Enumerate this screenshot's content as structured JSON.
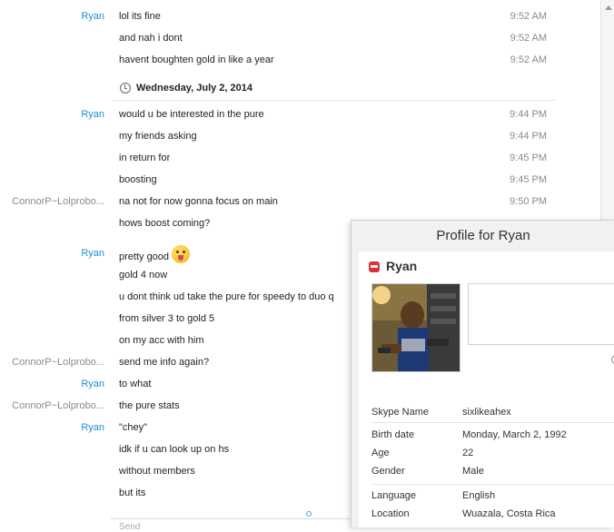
{
  "messages": [
    {
      "sender": "Ryan",
      "sender_type": "contact",
      "text": "lol its fine",
      "time": "9:52 AM"
    },
    {
      "sender": "",
      "sender_type": "contact",
      "text": "and nah i dont",
      "time": "9:52 AM"
    },
    {
      "sender": "",
      "sender_type": "contact",
      "text": "havent boughten gold in like a year",
      "time": "9:52 AM"
    }
  ],
  "date_separator": "Wednesday, July 2, 2014",
  "messages_after": [
    {
      "sender": "Ryan",
      "sender_type": "contact",
      "text": "would u be interested in the pure",
      "time": "9:44 PM"
    },
    {
      "sender": "",
      "sender_type": "contact",
      "text": "my friends asking",
      "time": "9:44 PM"
    },
    {
      "sender": "",
      "sender_type": "contact",
      "text": "in return for",
      "time": "9:45 PM"
    },
    {
      "sender": "",
      "sender_type": "contact",
      "text": "boosting",
      "time": "9:45 PM"
    },
    {
      "sender": "ConnorP~Lolprobo...",
      "sender_type": "self",
      "text": "na not for now gonna focus on main",
      "time": "9:50 PM"
    },
    {
      "sender": "",
      "sender_type": "self",
      "text": "hows boost coming?",
      "time": ""
    },
    {
      "sender": "Ryan",
      "sender_type": "contact",
      "text": "pretty good",
      "time": "",
      "emoji": "tongue-out-emoji"
    },
    {
      "sender": "",
      "sender_type": "contact",
      "text": "gold 4 now",
      "time": ""
    },
    {
      "sender": "",
      "sender_type": "contact",
      "text": "u dont think ud take the pure for speedy to duo q",
      "time": ""
    },
    {
      "sender": "",
      "sender_type": "contact",
      "text": "from silver 3 to gold 5",
      "time": ""
    },
    {
      "sender": "",
      "sender_type": "contact",
      "text": "on my acc with him",
      "time": ""
    },
    {
      "sender": "ConnorP~Lolprobo...",
      "sender_type": "self",
      "text": "send me info again?",
      "time": ""
    },
    {
      "sender": "Ryan",
      "sender_type": "contact",
      "text": "to what",
      "time": ""
    },
    {
      "sender": "ConnorP~Lolprobo...",
      "sender_type": "self",
      "text": "the pure stats",
      "time": ""
    },
    {
      "sender": "Ryan",
      "sender_type": "contact",
      "text": "\"chey\"",
      "time": ""
    },
    {
      "sender": "",
      "sender_type": "contact",
      "text": "idk if u can look up on hs",
      "time": ""
    },
    {
      "sender": "",
      "sender_type": "contact",
      "text": "without members",
      "time": ""
    },
    {
      "sender": "",
      "sender_type": "contact",
      "text": "but its",
      "time": ""
    }
  ],
  "compose_placeholder": "Send",
  "profile": {
    "title": "Profile for Ryan",
    "display_name": "Ryan",
    "fields": [
      {
        "label": "Skype Name",
        "value": "sixlikeahex"
      },
      {
        "label": "Birth date",
        "value": "Monday, March 2, 1992"
      },
      {
        "label": "Age",
        "value": "22"
      },
      {
        "label": "Gender",
        "value": "Male"
      },
      {
        "label": "Language",
        "value": "English"
      },
      {
        "label": "Location",
        "value": "Wuazala, Costa Rica"
      }
    ]
  },
  "colors": {
    "contact_name": "#1a8fd6",
    "self_name": "#8a8a8a",
    "skype_red": "#e0313b"
  }
}
